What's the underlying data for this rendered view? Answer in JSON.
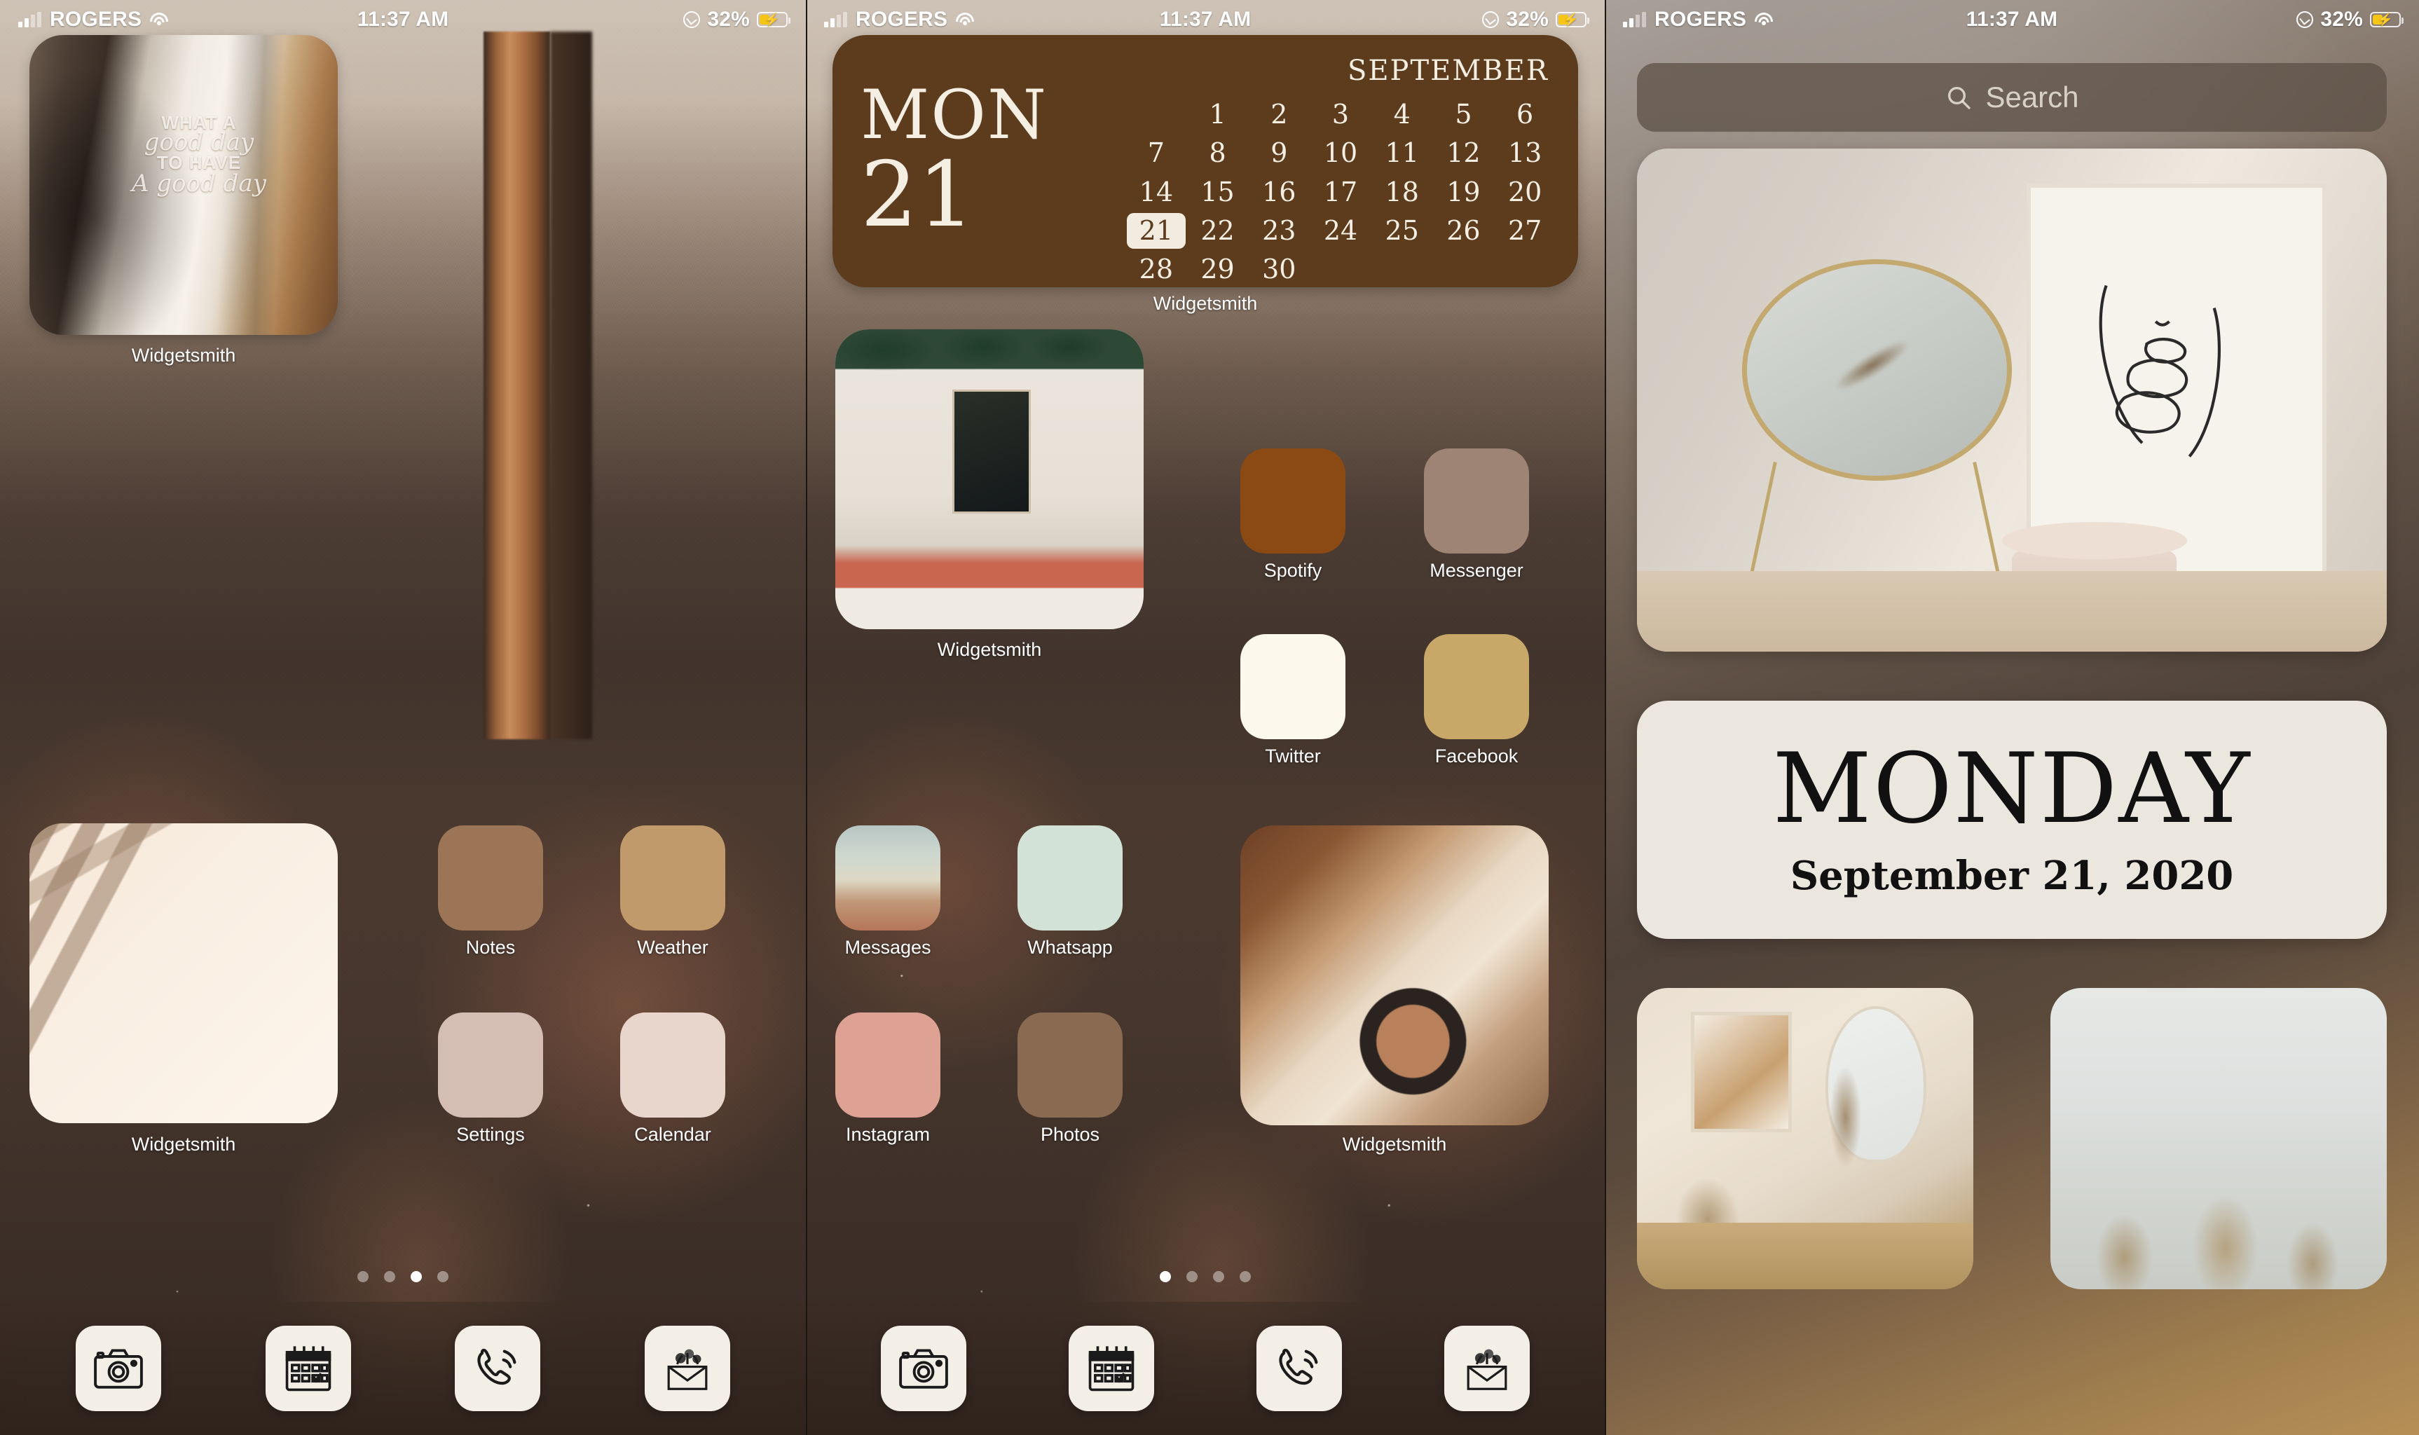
{
  "status_bar": {
    "carrier": "ROGERS",
    "time": "11:37 AM",
    "battery_percent": "32%",
    "wifi_icon": "wifi-icon",
    "signal_icon": "signal-bars-icon",
    "location_icon": "location-arrow-icon",
    "battery_icon": "battery-charging-icon"
  },
  "screen_left": {
    "widget_photo": {
      "caption": "Widgetsmith",
      "mirror_text": {
        "line1": "WHAT A",
        "line2": "good day",
        "line3": "TO HAVE",
        "line4": "A good day"
      }
    },
    "widget_palm": {
      "caption": "Widgetsmith"
    },
    "apps": [
      {
        "label": "Notes",
        "color": "#9C7456"
      },
      {
        "label": "Weather",
        "color": "#C19A6B"
      },
      {
        "label": "Settings",
        "color": "#D4BDB3"
      },
      {
        "label": "Calendar",
        "color": "#E8D5CC"
      }
    ],
    "page_dots": {
      "count": 4,
      "active_index": 2
    }
  },
  "screen_middle": {
    "calendar_widget": {
      "day_name": "MON",
      "day_number": "21",
      "month": "SEPTEMBER",
      "background_color": "#5C3C1D",
      "text_color": "#F5EFE3",
      "today": 21,
      "leading_blanks": 1,
      "days": [
        1,
        2,
        3,
        4,
        5,
        6,
        7,
        8,
        9,
        10,
        11,
        12,
        13,
        14,
        15,
        16,
        17,
        18,
        19,
        20,
        21,
        22,
        23,
        24,
        25,
        26,
        27,
        28,
        29,
        30
      ],
      "caption": "Widgetsmith"
    },
    "widget_cafe": {
      "caption": "Widgetsmith"
    },
    "widget_coffee": {
      "caption": "Widgetsmith"
    },
    "apps": [
      {
        "label": "Spotify",
        "color": "#8B4A13"
      },
      {
        "label": "Messenger",
        "color": "#9D8475"
      },
      {
        "label": "Twitter",
        "color": "#FDF8EC"
      },
      {
        "label": "Facebook",
        "color": "#C8A868"
      },
      {
        "label": "Messages",
        "color": "#C9C3B4"
      },
      {
        "label": "Whatsapp",
        "color": "#D3E2D6"
      },
      {
        "label": "Instagram",
        "color": "#DDA294"
      },
      {
        "label": "Photos",
        "color": "#8A6B51"
      }
    ],
    "page_dots": {
      "count": 4,
      "active_index": 0
    }
  },
  "screen_right": {
    "search": {
      "placeholder": "Search",
      "icon": "search-icon"
    },
    "date_widget": {
      "day": "MONDAY",
      "date": "September 21, 2020",
      "background_color": "#EBE7DF"
    }
  },
  "dock": {
    "items": [
      {
        "name": "camera",
        "icon": "camera-icon"
      },
      {
        "name": "calendar",
        "icon": "calendar-icon"
      },
      {
        "name": "phone",
        "icon": "phone-icon"
      },
      {
        "name": "mail",
        "icon": "mail-flowers-icon"
      }
    ]
  }
}
